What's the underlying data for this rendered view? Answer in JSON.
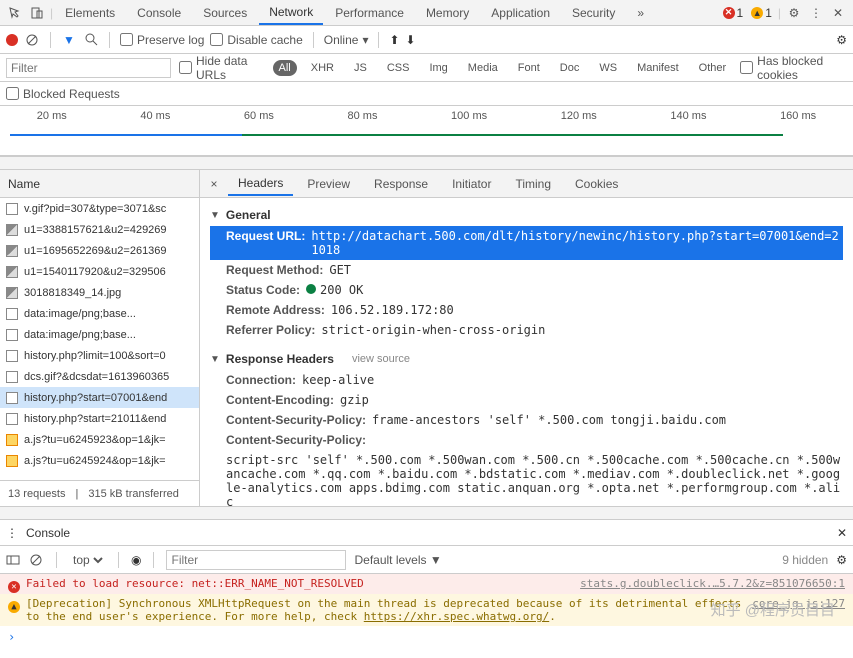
{
  "topTabs": {
    "items": [
      "Elements",
      "Console",
      "Sources",
      "Network",
      "Performance",
      "Memory",
      "Application",
      "Security"
    ],
    "activeIndex": 3,
    "more": "»",
    "errors": "1",
    "warnings": "1"
  },
  "recordBar": {
    "preserveLog": "Preserve log",
    "disableCache": "Disable cache",
    "online": "Online"
  },
  "filterBar": {
    "placeholder": "Filter",
    "hideDataUrls": "Hide data URLs",
    "types": [
      "All",
      "XHR",
      "JS",
      "CSS",
      "Img",
      "Media",
      "Font",
      "Doc",
      "WS",
      "Manifest",
      "Other"
    ],
    "activeTypeIndex": 0,
    "hasBlockedCookies": "Has blocked cookies"
  },
  "blockedRow": {
    "label": "Blocked Requests"
  },
  "timeline": {
    "labels": [
      "20 ms",
      "40 ms",
      "60 ms",
      "80 ms",
      "100 ms",
      "120 ms",
      "140 ms",
      "160 ms"
    ]
  },
  "requests": {
    "header": "Name",
    "items": [
      {
        "icon": "doc",
        "name": "v.gif?pid=307&type=3071&sc"
      },
      {
        "icon": "img",
        "name": "u1=3388157621&u2=429269"
      },
      {
        "icon": "img",
        "name": "u1=1695652269&u2=261369"
      },
      {
        "icon": "img",
        "name": "u1=1540117920&u2=329506"
      },
      {
        "icon": "img",
        "name": "3018818349_14.jpg"
      },
      {
        "icon": "doc",
        "name": "data:image/png;base..."
      },
      {
        "icon": "doc",
        "name": "data:image/png;base..."
      },
      {
        "icon": "doc",
        "name": "history.php?limit=100&sort=0"
      },
      {
        "icon": "doc",
        "name": "dcs.gif?&dcsdat=1613960365"
      },
      {
        "icon": "doc",
        "name": "history.php?start=07001&end",
        "selected": true
      },
      {
        "icon": "doc",
        "name": "history.php?start=21011&end"
      },
      {
        "icon": "js",
        "name": "a.js?tu=u6245923&op=1&jk="
      },
      {
        "icon": "js",
        "name": "a.js?tu=u6245924&op=1&jk="
      }
    ],
    "status": {
      "count": "13 requests",
      "transferred": "315 kB transferred"
    }
  },
  "detail": {
    "tabs": [
      "Headers",
      "Preview",
      "Response",
      "Initiator",
      "Timing",
      "Cookies"
    ],
    "activeIndex": 0,
    "general": {
      "title": "General",
      "requestUrlLabel": "Request URL:",
      "requestUrl": "http://datachart.500.com/dlt/history/newinc/history.php?start=07001&end=21018",
      "requestMethodLabel": "Request Method:",
      "requestMethod": "GET",
      "statusCodeLabel": "Status Code:",
      "statusCode": "200 OK",
      "remoteAddressLabel": "Remote Address:",
      "remoteAddress": "106.52.189.172:80",
      "referrerPolicyLabel": "Referrer Policy:",
      "referrerPolicy": "strict-origin-when-cross-origin"
    },
    "responseHeaders": {
      "title": "Response Headers",
      "viewSource": "view source",
      "connectionLabel": "Connection:",
      "connection": "keep-alive",
      "contentEncodingLabel": "Content-Encoding:",
      "contentEncoding": "gzip",
      "csp1Label": "Content-Security-Policy:",
      "csp1": "frame-ancestors 'self' *.500.com tongji.baidu.com",
      "csp2Label": "Content-Security-Policy:",
      "csp2": "script-src 'self' *.500.com *.500wan.com *.500.cn *.500cache.com *.500cache.cn *.500wancache.com *.qq.com *.baidu.com *.bdstatic.com *.mediav.com *.doubleclick.net *.google-analytics.com apps.bdimg.com static.anquan.org *.opta.net  *.performgroup.com *.alic"
    }
  },
  "console": {
    "title": "Console",
    "context": "top",
    "filterPlaceholder": "Filter",
    "levels": "Default levels ▼",
    "hidden": "9 hidden",
    "errorMsg": "Failed to load resource: net::ERR_NAME_NOT_RESOLVED",
    "errorSrc": "stats.g.doubleclick.…5.7.2&z=851076650:1",
    "warnMsg": "[Deprecation] Synchronous XMLHttpRequest on the main thread is deprecated because of its detrimental effects to the end user's experience. For more help, check ",
    "warnLink": "https://xhr.spec.whatwg.org/",
    "warnSrc": "core_jg.js:127"
  },
  "watermark": "知乎 @程序员目目"
}
